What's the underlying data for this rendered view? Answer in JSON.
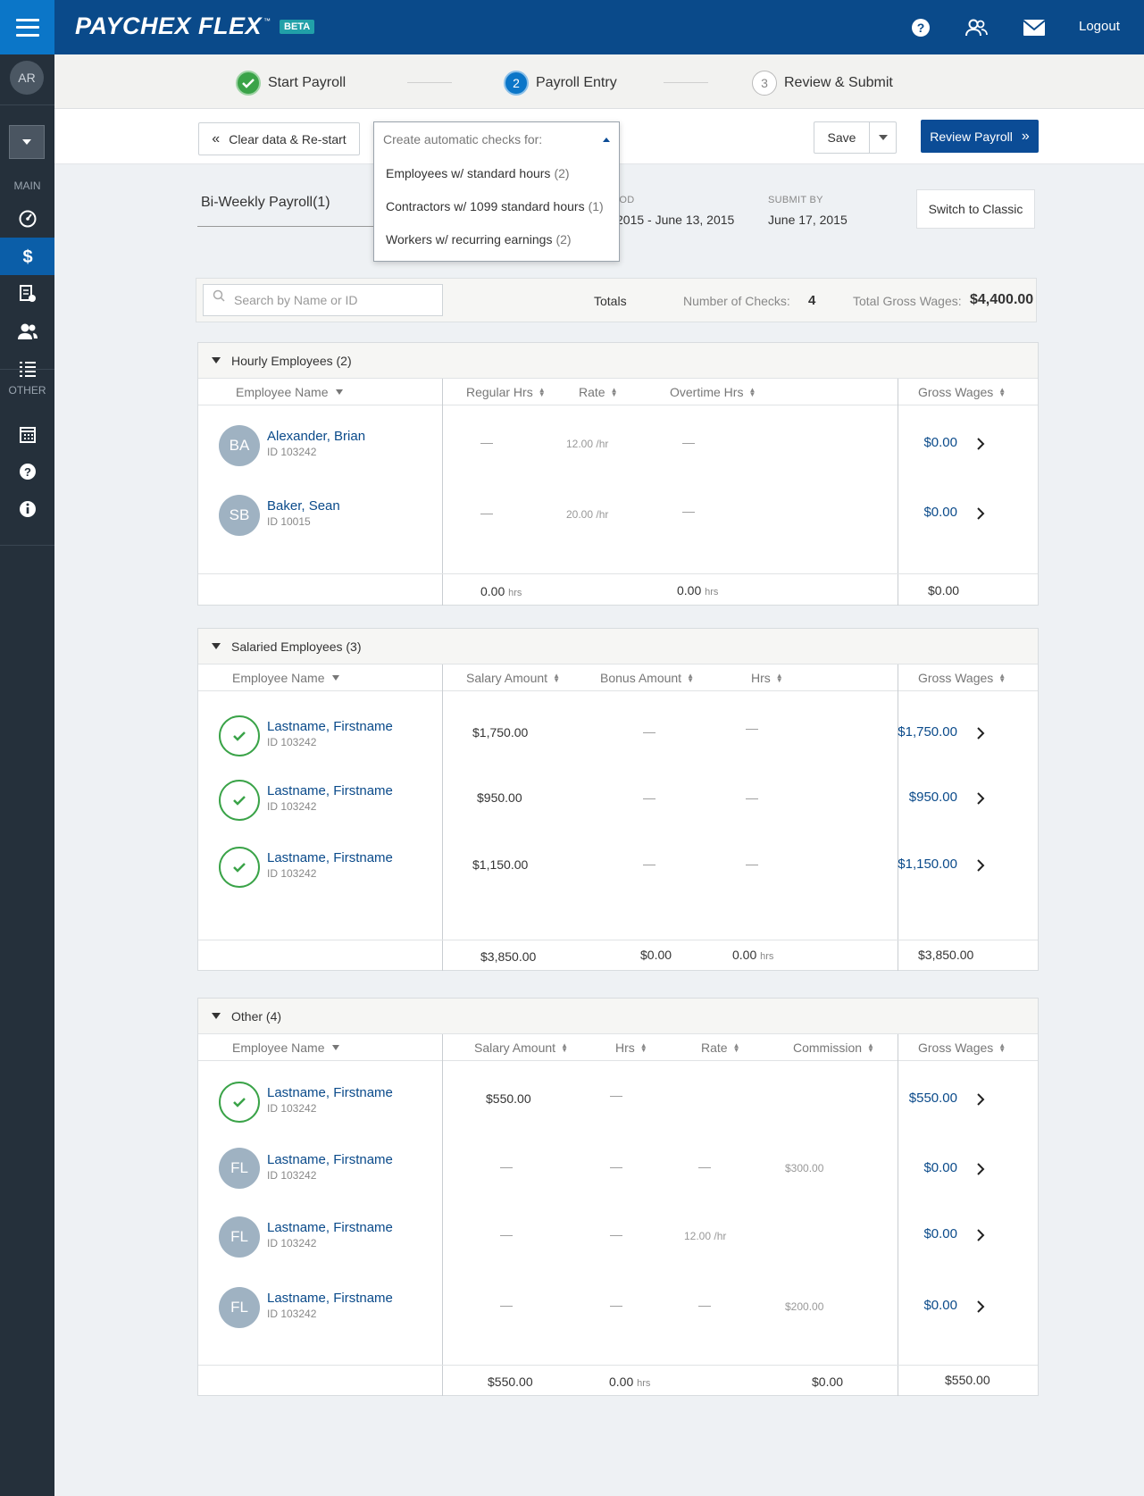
{
  "header": {
    "brand": "PAYCHEX FLEX",
    "tm": "™",
    "beta": "BETA",
    "logout": "Logout"
  },
  "sidebar": {
    "avatar": "AR",
    "main_label": "MAIN",
    "other_label": "OTHER"
  },
  "steps": [
    {
      "label": "Start Payroll",
      "number": ""
    },
    {
      "label": "Payroll Entry",
      "number": "2"
    },
    {
      "label": "Review & Submit",
      "number": "3"
    }
  ],
  "toolbar": {
    "clear_label": "Clear data & Re-start",
    "save_label": "Save",
    "review_label": "Review Payroll"
  },
  "dropdown": {
    "placeholder": "Create automatic checks for:",
    "options": [
      {
        "label": "Employees w/ standard hours",
        "count": "(2)"
      },
      {
        "label": "Contractors w/ 1099 standard hours",
        "count": "(1)"
      },
      {
        "label": "Workers w/ recurring earnings",
        "count": "(2)"
      }
    ]
  },
  "payroll": {
    "name": "Bi-Weekly Payroll(1)",
    "period_label": "IOD",
    "period_value": "2015 - June 13, 2015",
    "submit_label": "SUBMIT BY",
    "submit_value": "June 17, 2015",
    "switch_label": "Switch to Classic"
  },
  "totals": {
    "search_placeholder": "Search by Name or ID",
    "label": "Totals",
    "checks_label": "Number of Checks:",
    "checks_value": "4",
    "gross_label": "Total Gross Wages:",
    "gross_value": "$4,400.00"
  },
  "hourly": {
    "title": "Hourly Employees (2)",
    "cols": [
      "Employee Name",
      "Regular Hrs",
      "Rate",
      "Overtime Hrs",
      "Gross Wages"
    ],
    "rows": [
      {
        "initials": "BA",
        "name": "Alexander, Brian",
        "id": "ID 103242",
        "reg": "—",
        "rate": "12.00 /hr",
        "ot": "—",
        "gross": "$0.00"
      },
      {
        "initials": "SB",
        "name": "Baker, Sean",
        "id": "ID 10015",
        "reg": "—",
        "rate": "20.00 /hr",
        "ot": "—",
        "gross": "$0.00"
      }
    ],
    "footer": {
      "reg": "0.00",
      "reg_unit": "hrs",
      "ot": "0.00",
      "ot_unit": "hrs",
      "gross": "$0.00"
    }
  },
  "salaried": {
    "title": "Salaried Employees (3)",
    "cols": [
      "Employee Name",
      "Salary Amount",
      "Bonus Amount",
      "Hrs",
      "Gross Wages"
    ],
    "rows": [
      {
        "name": "Lastname, Firstname",
        "id": "ID 103242",
        "salary": "$1,750.00",
        "bonus": "—",
        "hrs": "—",
        "gross": "$1,750.00"
      },
      {
        "name": "Lastname, Firstname",
        "id": "ID 103242",
        "salary": "$950.00",
        "bonus": "—",
        "hrs": "—",
        "gross": "$950.00"
      },
      {
        "name": "Lastname, Firstname",
        "id": "ID 103242",
        "salary": "$1,150.00",
        "bonus": "—",
        "hrs": "—",
        "gross": "$1,150.00"
      }
    ],
    "footer": {
      "salary": "$3,850.00",
      "bonus": "$0.00",
      "hrs": "0.00",
      "hrs_unit": "hrs",
      "gross": "$3,850.00"
    }
  },
  "other": {
    "title": "Other (4)",
    "cols": [
      "Employee Name",
      "Salary Amount",
      "Hrs",
      "Rate",
      "Commission",
      "Gross Wages"
    ],
    "rows": [
      {
        "initials": "",
        "name": "Lastname, Firstname",
        "id": "ID 103242",
        "salary": "$550.00",
        "hrs": "—",
        "rate": "",
        "commission": "",
        "gross": "$550.00"
      },
      {
        "initials": "FL",
        "name": "Lastname, Firstname",
        "id": "ID 103242",
        "salary": "—",
        "hrs": "—",
        "rate": "—",
        "commission": "$300.00",
        "gross": "$0.00"
      },
      {
        "initials": "FL",
        "name": "Lastname, Firstname",
        "id": "ID 103242",
        "salary": "—",
        "hrs": "—",
        "rate": "12.00 /hr",
        "commission": "",
        "gross": "$0.00"
      },
      {
        "initials": "FL",
        "name": "Lastname, Firstname",
        "id": "ID 103242",
        "salary": "—",
        "hrs": "—",
        "rate": "—",
        "commission": "$200.00",
        "gross": "$0.00"
      }
    ],
    "footer": {
      "salary": "$550.00",
      "hrs": "0.00",
      "hrs_unit": "hrs",
      "commission": "$0.00",
      "gross": "$550.00"
    }
  },
  "colors": {
    "brand": "#0a4a8a",
    "accent": "#0b76c8",
    "sidebar": "#25303b",
    "success": "#3aa348",
    "link": "#0a4a8a"
  },
  "icons": [
    "menu-icon",
    "help-icon",
    "people-icon",
    "mail-icon",
    "dashboard-icon",
    "dollar-icon",
    "report-icon",
    "employees-icon",
    "list-icon",
    "calendar-icon",
    "question-icon",
    "info-icon",
    "check-icon",
    "search-icon",
    "chevron-right-icon"
  ]
}
